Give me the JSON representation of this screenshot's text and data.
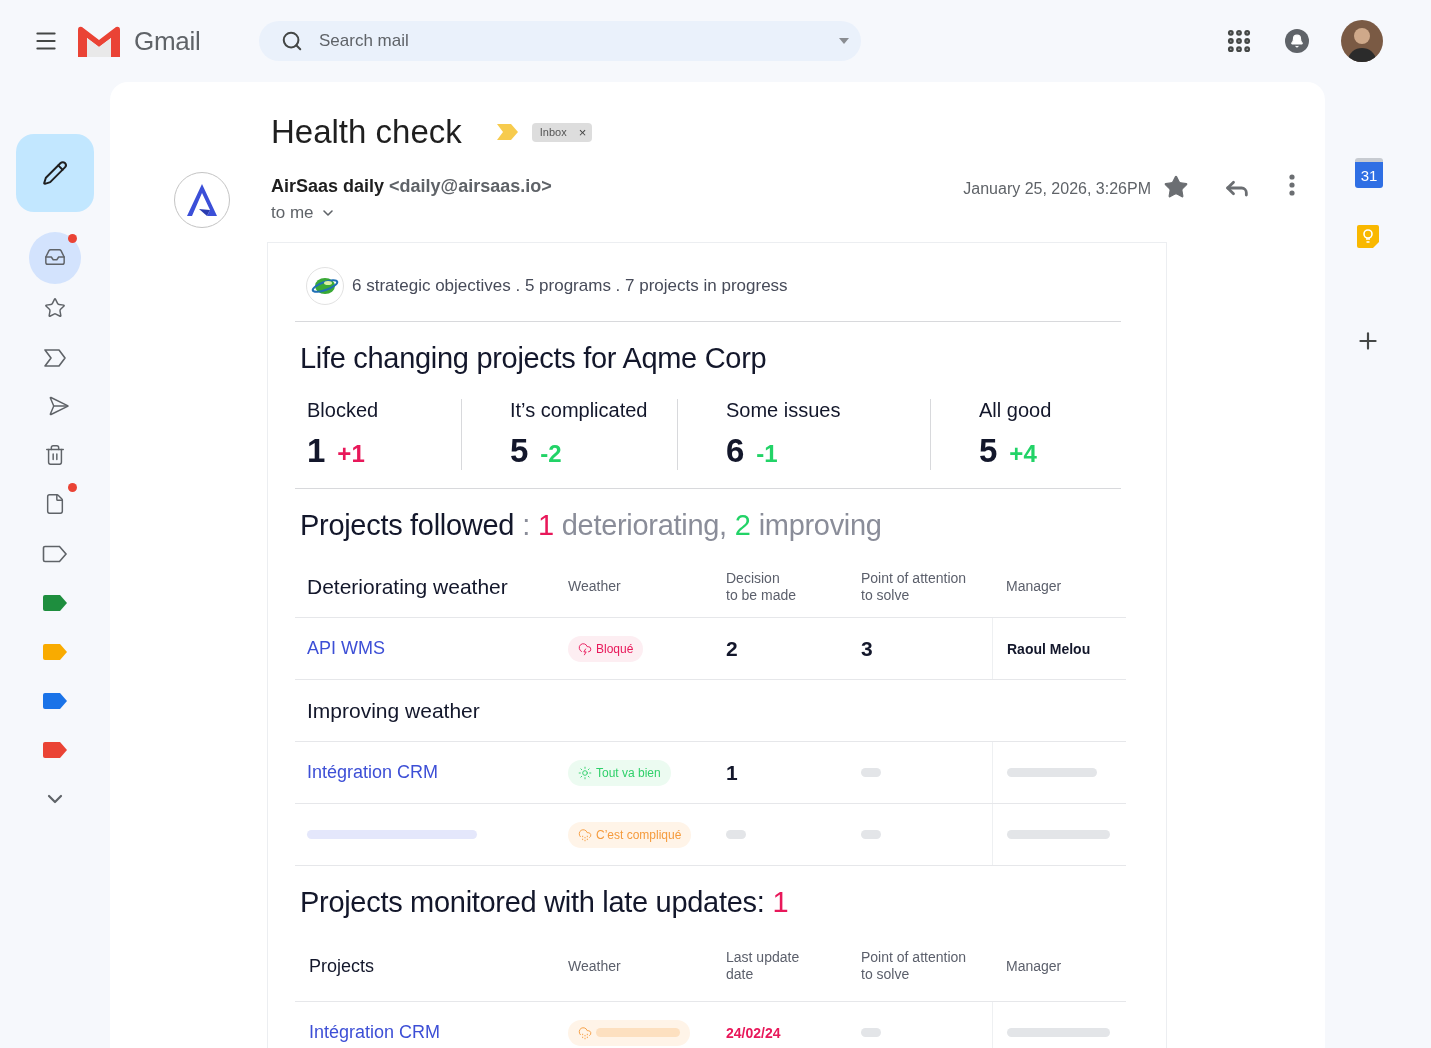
{
  "app": {
    "name": "Gmail"
  },
  "search": {
    "placeholder": "Search mail"
  },
  "nav": [
    {
      "kind": "inbox",
      "selected": true,
      "badge": true
    },
    {
      "kind": "star",
      "selected": false,
      "badge": false
    },
    {
      "kind": "important",
      "selected": false,
      "badge": false
    },
    {
      "kind": "sent",
      "selected": false,
      "badge": false
    },
    {
      "kind": "trash",
      "selected": false,
      "badge": false
    },
    {
      "kind": "draft",
      "selected": false,
      "badge": true
    },
    {
      "kind": "label",
      "selected": false,
      "badge": false
    },
    {
      "kind": "label",
      "selected": false,
      "badge": false,
      "color": "#1e8e3e"
    },
    {
      "kind": "label",
      "selected": false,
      "badge": false,
      "color": "#f9ab00"
    },
    {
      "kind": "label",
      "selected": false,
      "badge": false,
      "color": "#1a73e8"
    },
    {
      "kind": "label",
      "selected": false,
      "badge": false,
      "color": "#ea4335"
    },
    {
      "kind": "more",
      "selected": false,
      "badge": false
    }
  ],
  "right_rail": {
    "calendar_day": "31"
  },
  "email": {
    "subject": "Health check",
    "label": "Inbox",
    "label_remove": "×",
    "sender_name": "AirSaas daily",
    "sender_address": "<daily@airsaas.io>",
    "recipient": "to me",
    "date": "January 25, 2026, 3:26PM"
  },
  "digest": {
    "summary": "6 strategic objectives . 5 programs . 7 projects in progress",
    "title": "Life changing projects for Aqme Corp",
    "stats": [
      {
        "label": "Blocked",
        "count": "1",
        "delta": "+1",
        "color": "#e8185a"
      },
      {
        "label": "It’s complicated",
        "count": "5",
        "delta": "-2",
        "color": "#22d367"
      },
      {
        "label": "Some issues",
        "count": "6",
        "delta": "-1",
        "color": "#22d367"
      },
      {
        "label": "All good",
        "count": "5",
        "delta": "+4",
        "color": "#22d367"
      }
    ],
    "followed": {
      "heading": [
        {
          "text": "Projects followed",
          "color": "#13172b"
        },
        {
          "text": ":",
          "color": "#8a8d99"
        },
        {
          "text": "1",
          "color": "#e8185a"
        },
        {
          "text": "deteriorating,",
          "color": "#8a8d99"
        },
        {
          "text": "2",
          "color": "#22d367"
        },
        {
          "text": "improving",
          "color": "#8a8d99"
        }
      ],
      "columns": [
        "Weather",
        "Decision\nto be made",
        "Point of attention\nto solve",
        "Manager"
      ],
      "groups": [
        {
          "title": "Deteriorating weather",
          "rows": [
            {
              "project": "API WMS",
              "weather": {
                "kind": "blocked",
                "label": "Bloqué"
              },
              "decisions": "2",
              "points": "3",
              "manager": "Raoul Melou"
            }
          ]
        },
        {
          "title": "Improving weather",
          "rows": [
            {
              "project": "Intégration CRM",
              "weather": {
                "kind": "good",
                "label": "Tout va bien"
              },
              "decisions": "1"
            },
            {
              "weather": {
                "kind": "complicated",
                "label": "C’est compliqué"
              }
            }
          ]
        }
      ]
    },
    "late": {
      "heading": [
        {
          "text": "Projects monitored with late updates:",
          "color": "#13172b"
        },
        {
          "text": "1",
          "color": "#e8185a"
        }
      ],
      "columns": [
        "Projects",
        "Weather",
        "Last update\ndate",
        "Point of attention\nto solve",
        "Manager"
      ],
      "rows": [
        {
          "project": "Intégration CRM",
          "weather": {
            "kind": "complicated"
          },
          "last_update": "24/02/24"
        }
      ]
    }
  }
}
